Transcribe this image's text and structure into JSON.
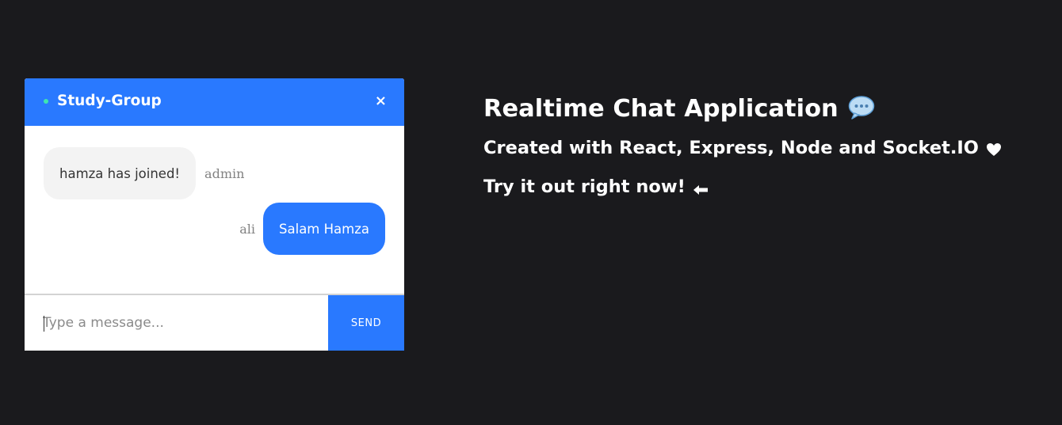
{
  "chat": {
    "room_name": "Study-Group",
    "close_label": "×",
    "status": "online",
    "messages": [
      {
        "text": "hamza has joined!",
        "sender": "admin",
        "own": false
      },
      {
        "text": "Salam Hamza",
        "sender": "ali",
        "own": true
      }
    ],
    "input": {
      "value": "",
      "placeholder": "Type a message..."
    },
    "send_label": "SEND"
  },
  "info": {
    "title": "Realtime Chat Application",
    "subtitle": "Created with React, Express, Node and Socket.IO",
    "cta": "Try it out right now!",
    "icons": {
      "title": "speech-bubble-icon",
      "subtitle": "heart-icon",
      "cta": "left-arrow-icon"
    }
  },
  "colors": {
    "background": "#1a1a1d",
    "accent": "#2979ff",
    "online": "#3ee6b0",
    "admin_bubble": "#f3f3f3",
    "sender_text": "#828282"
  }
}
